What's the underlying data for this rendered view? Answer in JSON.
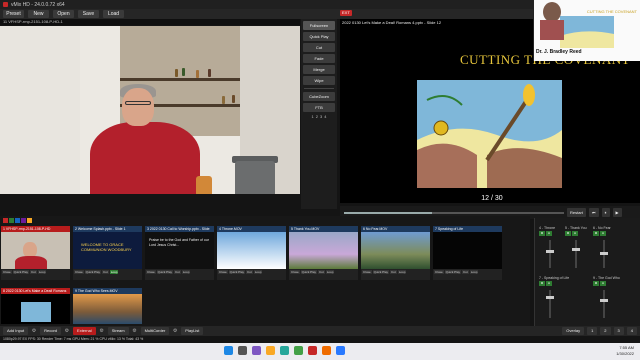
{
  "window": {
    "title": "vMix HD - 24.0.0.72 x64",
    "controls": [
      "—",
      "□",
      "✕"
    ]
  },
  "menu": [
    "Preset",
    "New",
    "Open",
    "Save",
    "Load"
  ],
  "preview": {
    "label": "11 VFHSP-rmp-2151-108-P-HD-1"
  },
  "transitions": {
    "buttons": [
      "Fullscreen",
      "Quick Play",
      "Cut",
      "Fade",
      "Merge",
      "Wipe",
      "CubeZoom",
      "FTB"
    ],
    "numbers": [
      "1",
      "2",
      "3",
      "4"
    ]
  },
  "output": {
    "badge": "EXT",
    "label": "2022 0130 Let's Make a Deal! Romans 4.pptx - Slide 12",
    "slide_title": "CUTTING THE COVENANT",
    "slide_counter": "12 / 30"
  },
  "inset": {
    "title": "CUTTING THE COVENANT",
    "name": "Dr. J. Bradley Reed"
  },
  "playback": {
    "progress": 0.4,
    "buttons": [
      "Restart",
      "⏮",
      "⏸",
      "▶"
    ],
    "audio_label": "Audio Mixer"
  },
  "inputs": [
    {
      "num": "1",
      "title": "1 VFHSP-rmp-2151-108-P-HD",
      "ctrls": [
        "Close",
        "Quick Play",
        "Cut",
        "Loop"
      ]
    },
    {
      "num": "2",
      "title": "2 Welcome Splash.pptx - Slide 1",
      "ctrls": [
        "Close",
        "Quick Play",
        "Cut",
        "Loop"
      ]
    },
    {
      "num": "3",
      "title": "3 2022 0130 Call to Worship.pptx - Slide",
      "ctrls": [
        "Close",
        "Quick Play",
        "Cut",
        "Loop"
      ]
    },
    {
      "num": "4",
      "title": "4 Throne.MOV",
      "ctrls": [
        "Close",
        "Quick Play",
        "Cut",
        "Loop"
      ]
    },
    {
      "num": "5",
      "title": "5 Thank You.MOV",
      "ctrls": [
        "Close",
        "Quick Play",
        "Cut",
        "Loop"
      ]
    },
    {
      "num": "6",
      "title": "6 No Fear.MOV",
      "ctrls": [
        "Close",
        "Quick Play",
        "Cut",
        "Loop"
      ]
    },
    {
      "num": "7",
      "title": "7 Speaking of Life",
      "ctrls": [
        "Close",
        "Quick Play",
        "Cut",
        "Loop"
      ]
    },
    {
      "num": "8",
      "title": "8 2022 0130 Let's Make a Deal! Romans",
      "ctrls": [
        "Close",
        "Quick Play",
        "Cut",
        "Loop"
      ]
    },
    {
      "num": "9",
      "title": "9 The God Who Sees.MOV",
      "ctrls": [
        "Close",
        "Quick Play",
        "Cut",
        "Loop"
      ]
    }
  ],
  "slide2_text": "WELCOME TO GRACE COMMUNION WOODBURY",
  "slide3_text": "Praise be to the God and Father of our Lord Jesus Christ...",
  "mixer": {
    "strips": [
      "4 - Throne",
      "5 - Thank You",
      "6 - No Fear",
      "7 - Speaking of Life",
      "9 - The God Who"
    ],
    "buttons": [
      "M",
      "A",
      "B"
    ]
  },
  "toolbar": {
    "add_input": "Add Input",
    "record": "Record",
    "external": "External",
    "stream": "Stream",
    "multicorder": "MultiCorder",
    "playlist": "PlayList",
    "overlay": "Overlay",
    "numbers": [
      "1",
      "2",
      "3",
      "4"
    ]
  },
  "status": {
    "text": "1080p29.97  EX  FPS: 30  Render Time: 7 ms  GPU Mem: 21 %  CPU vMix: 13 %  Total: 43 %"
  },
  "clock": {
    "time": "7:55 AM",
    "date": "1/30/2022"
  }
}
